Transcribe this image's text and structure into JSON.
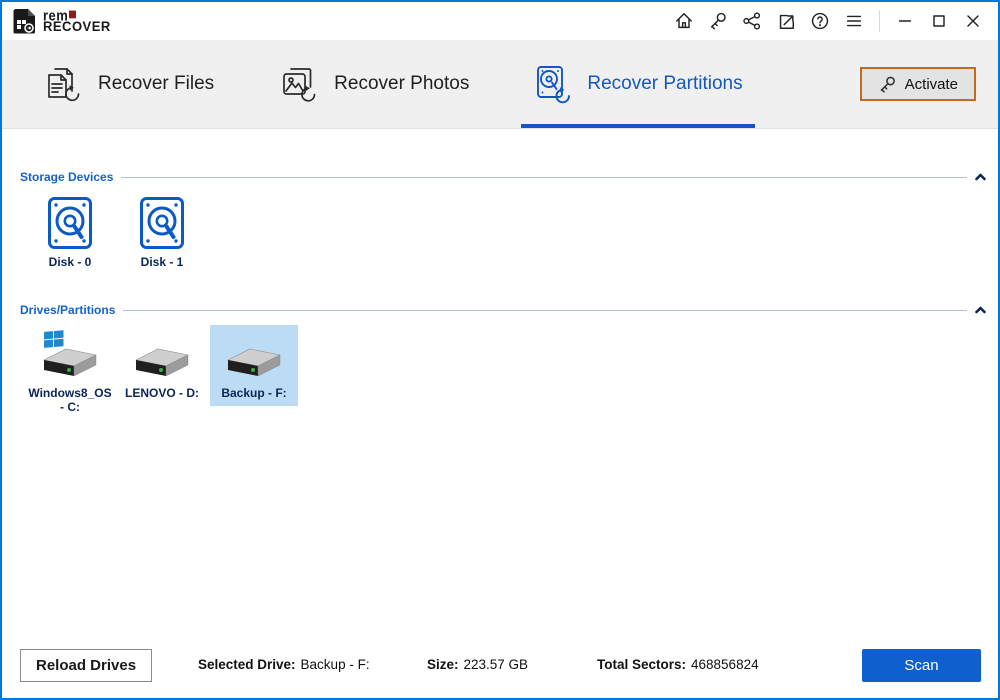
{
  "brand": {
    "line1": "rem",
    "line2": "RECOVER"
  },
  "titlebar": {
    "icons": [
      "home-icon",
      "key-icon",
      "share-icon",
      "open-external-icon",
      "help-icon",
      "menu-icon",
      "minimize-icon",
      "maximize-icon",
      "close-icon"
    ]
  },
  "tabs": [
    {
      "label": "Recover Files",
      "active": false
    },
    {
      "label": "Recover Photos",
      "active": false
    },
    {
      "label": "Recover Partitions",
      "active": true
    }
  ],
  "activate": {
    "label": "Activate"
  },
  "sections": [
    {
      "title": "Storage Devices",
      "items": [
        {
          "label": "Disk - 0",
          "selected": false
        },
        {
          "label": "Disk - 1",
          "selected": false
        }
      ]
    },
    {
      "title": "Drives/Partitions",
      "items": [
        {
          "label": "Windows8_OS - C:",
          "selected": false
        },
        {
          "label": "LENOVO - D:",
          "selected": false
        },
        {
          "label": "Backup - F:",
          "selected": true
        }
      ]
    }
  ],
  "footer": {
    "reload_label": "Reload Drives",
    "stats": [
      {
        "label": "Selected Drive:",
        "value": "Backup - F:"
      },
      {
        "label": "Size:",
        "value": "223.57 GB"
      },
      {
        "label": "Total Sectors:",
        "value": "468856824"
      }
    ],
    "scan_label": "Scan"
  },
  "colors": {
    "window_border": "#0078D7",
    "accent_blue": "#1356C4",
    "section_blue": "#1464C8",
    "navy_text": "#0A2558",
    "selection_blue": "#BCDCF5",
    "activate_border": "#C06A1F",
    "tabbar_bg": "#F0F0F0",
    "scan_blue": "#0F5FCE",
    "logo_red": "#8B1D15",
    "disk_icon_blue": "#0A5AC8",
    "windows_logo_blue": "#1E88D2"
  }
}
